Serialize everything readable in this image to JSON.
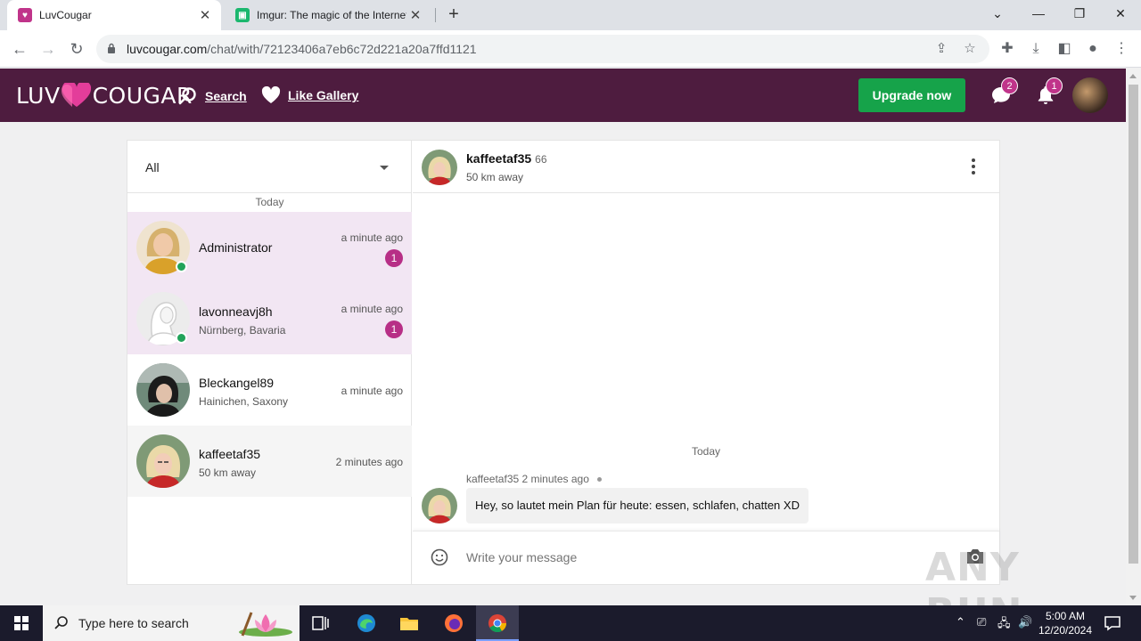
{
  "browser": {
    "tabs": [
      {
        "title": "LuvCougar",
        "active": true
      },
      {
        "title": "Imgur: The magic of the Internet",
        "active": false
      }
    ],
    "url_host": "luvcougar.com",
    "url_path": "/chat/with/72123406a7eb6c72d221a20a7ffd1121"
  },
  "site": {
    "logo_left": "LUV",
    "logo_right": "COUGAR",
    "nav": [
      {
        "label": "Search",
        "icon": "search-icon"
      },
      {
        "label": "Like Gallery",
        "icon": "heart-icon"
      }
    ],
    "upgrade_label": "Upgrade now",
    "messages_badge": "2",
    "notifications_badge": "1",
    "brand_color": "#4e1c3f",
    "accent_color": "#b72f86",
    "upgrade_color": "#16a34a"
  },
  "chat": {
    "filter_value": "All",
    "list_day_label": "Today",
    "conversations": [
      {
        "name": "Administrator",
        "location": "",
        "time": "a minute ago",
        "unread": "1",
        "online": true,
        "state": "unread"
      },
      {
        "name": "lavonneavj8h",
        "location": "Nürnberg, Bavaria",
        "time": "a minute ago",
        "unread": "1",
        "online": true,
        "state": "unread"
      },
      {
        "name": "Bleckangel89",
        "location": "Hainichen, Saxony",
        "time": "a minute ago",
        "unread": "",
        "online": false,
        "state": "read"
      },
      {
        "name": "kaffeetaf35",
        "location": "50 km away",
        "time": "2 minutes ago",
        "unread": "",
        "online": false,
        "state": "selected"
      }
    ],
    "active": {
      "name": "kaffeetaf35",
      "age": "66",
      "distance": "50 km away"
    },
    "messages_day_label": "Today",
    "messages": [
      {
        "sender": "kaffeetaf35",
        "time": "2 minutes ago",
        "text": "Hey, so lautet mein Plan für heute: essen, schlafen, chatten XD"
      }
    ],
    "composer_placeholder": "Write your message"
  },
  "watermark": "ANY RUN",
  "taskbar": {
    "search_placeholder": "Type here to search",
    "time": "5:00 AM",
    "date": "12/20/2024"
  }
}
